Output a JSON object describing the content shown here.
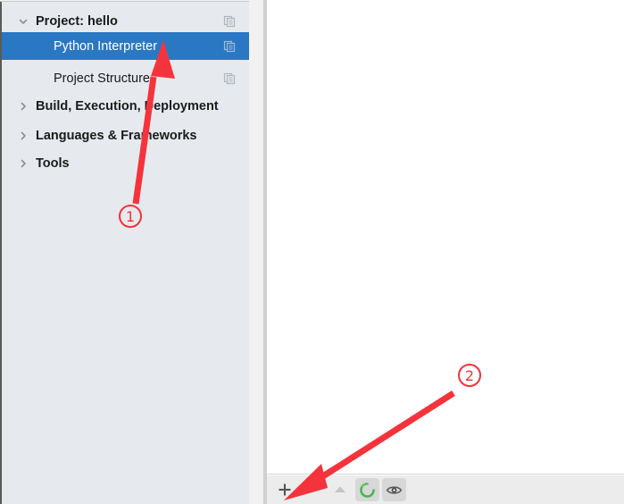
{
  "window": {
    "kind": "settings-dialog",
    "accent_selection_color": "#2a78c4",
    "annotation_color": "#f0323c",
    "sidebar_bg": "#e6eaee",
    "toolbar_bg": "#ececec"
  },
  "sidebar": {
    "items": [
      {
        "label": "Project: hello",
        "level": 1,
        "bold": true,
        "twisty": "chevron-down-icon",
        "selected": false,
        "trailing_icon": "copy-icon",
        "name": "sidebar-item-project-hello"
      },
      {
        "label": "Python Interpreter",
        "level": 2,
        "bold": false,
        "twisty": "",
        "selected": true,
        "trailing_icon": "copy-icon",
        "name": "sidebar-item-python-interpreter"
      },
      {
        "label": "Project Structure",
        "level": 2,
        "bold": false,
        "twisty": "",
        "selected": false,
        "trailing_icon": "copy-icon",
        "name": "sidebar-item-project-structure"
      },
      {
        "label": "Build, Execution, Deployment",
        "level": 1,
        "bold": true,
        "twisty": "chevron-right-icon",
        "selected": false,
        "trailing_icon": "",
        "name": "sidebar-item-build-execution-deployment"
      },
      {
        "label": "Languages & Frameworks",
        "level": 1,
        "bold": true,
        "twisty": "chevron-right-icon",
        "selected": false,
        "trailing_icon": "",
        "name": "sidebar-item-languages-frameworks"
      },
      {
        "label": "Tools",
        "level": 1,
        "bold": true,
        "twisty": "chevron-right-icon",
        "selected": false,
        "trailing_icon": "",
        "name": "sidebar-item-tools"
      }
    ]
  },
  "main": {
    "list": {
      "items": [],
      "empty": true
    },
    "toolbar": {
      "buttons": [
        {
          "name": "add-button",
          "icon": "plus-icon",
          "label": "+",
          "enabled": true,
          "framed": false
        },
        {
          "name": "remove-button",
          "icon": "minus-icon",
          "label": "−",
          "enabled": false,
          "framed": false
        },
        {
          "name": "move-up-button",
          "icon": "triangle-up-icon",
          "label": "▲",
          "enabled": false,
          "framed": false
        },
        {
          "name": "refresh-button",
          "icon": "refresh-circle-icon",
          "label": "",
          "enabled": true,
          "framed": true
        },
        {
          "name": "show-paths-button",
          "icon": "eye-icon",
          "label": "",
          "enabled": true,
          "framed": true
        }
      ]
    }
  },
  "annotations": {
    "markers": [
      {
        "id": "1",
        "label": "①",
        "text": "1",
        "points_to": "sidebar-item-python-interpreter"
      },
      {
        "id": "2",
        "label": "②",
        "text": "2",
        "points_to": "add-button"
      }
    ]
  }
}
